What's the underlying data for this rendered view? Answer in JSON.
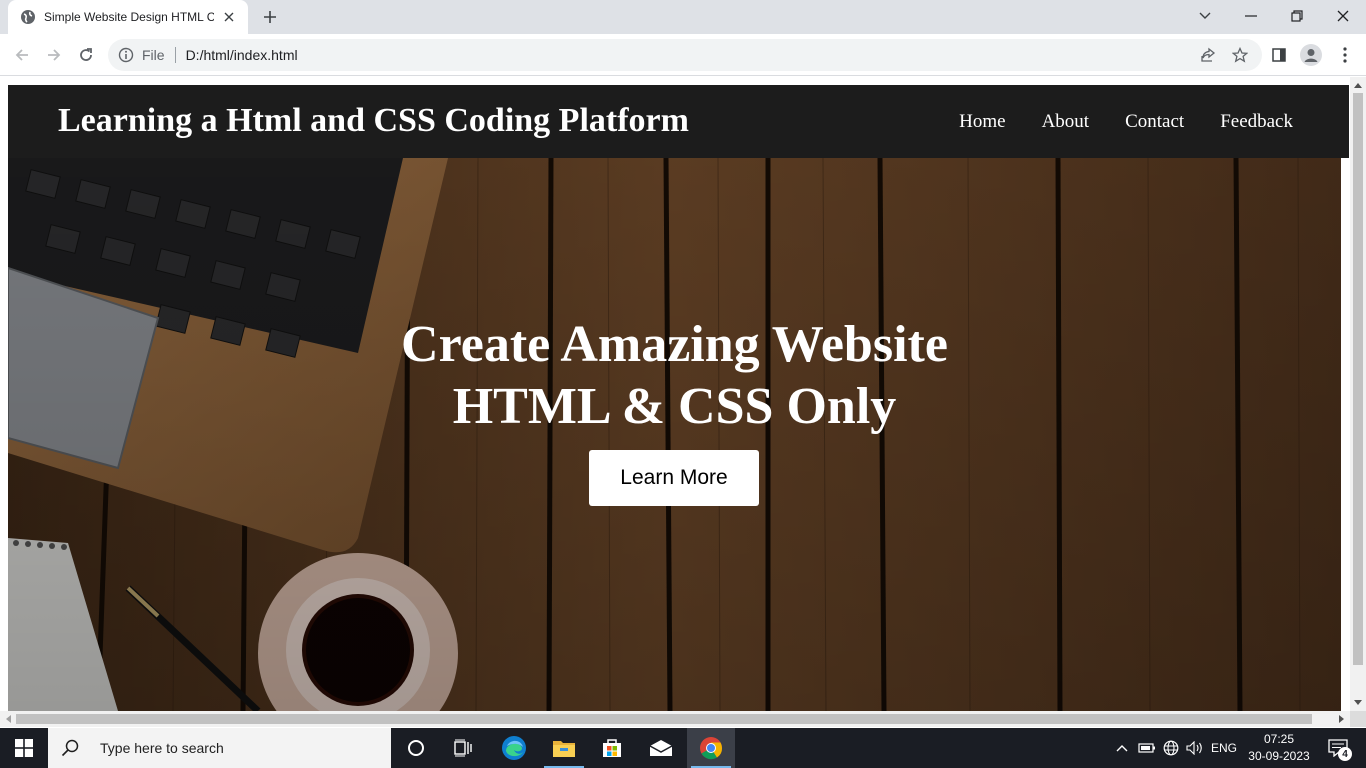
{
  "browser": {
    "tab_title": "Simple Website Design HTML CS",
    "omnibox_scheme": "File",
    "url": "D:/html/index.html"
  },
  "site": {
    "logo": "Learning a Html and CSS Coding Platform",
    "nav": [
      {
        "label": "Home"
      },
      {
        "label": "About"
      },
      {
        "label": "Contact"
      },
      {
        "label": "Feedback"
      }
    ],
    "hero": {
      "line1": "Create Amazing Website",
      "line2": "HTML & CSS Only",
      "cta": "Learn More"
    }
  },
  "taskbar": {
    "search_placeholder": "Type here to search",
    "language": "ENG",
    "time": "07:25",
    "date": "30-09-2023",
    "notification_count": "4"
  },
  "colors": {
    "header_bg": "#1c1c1c",
    "hero_wood": "#5a3b22",
    "tabstrip": "#dee1e6",
    "taskbar": "#1a1d24"
  }
}
